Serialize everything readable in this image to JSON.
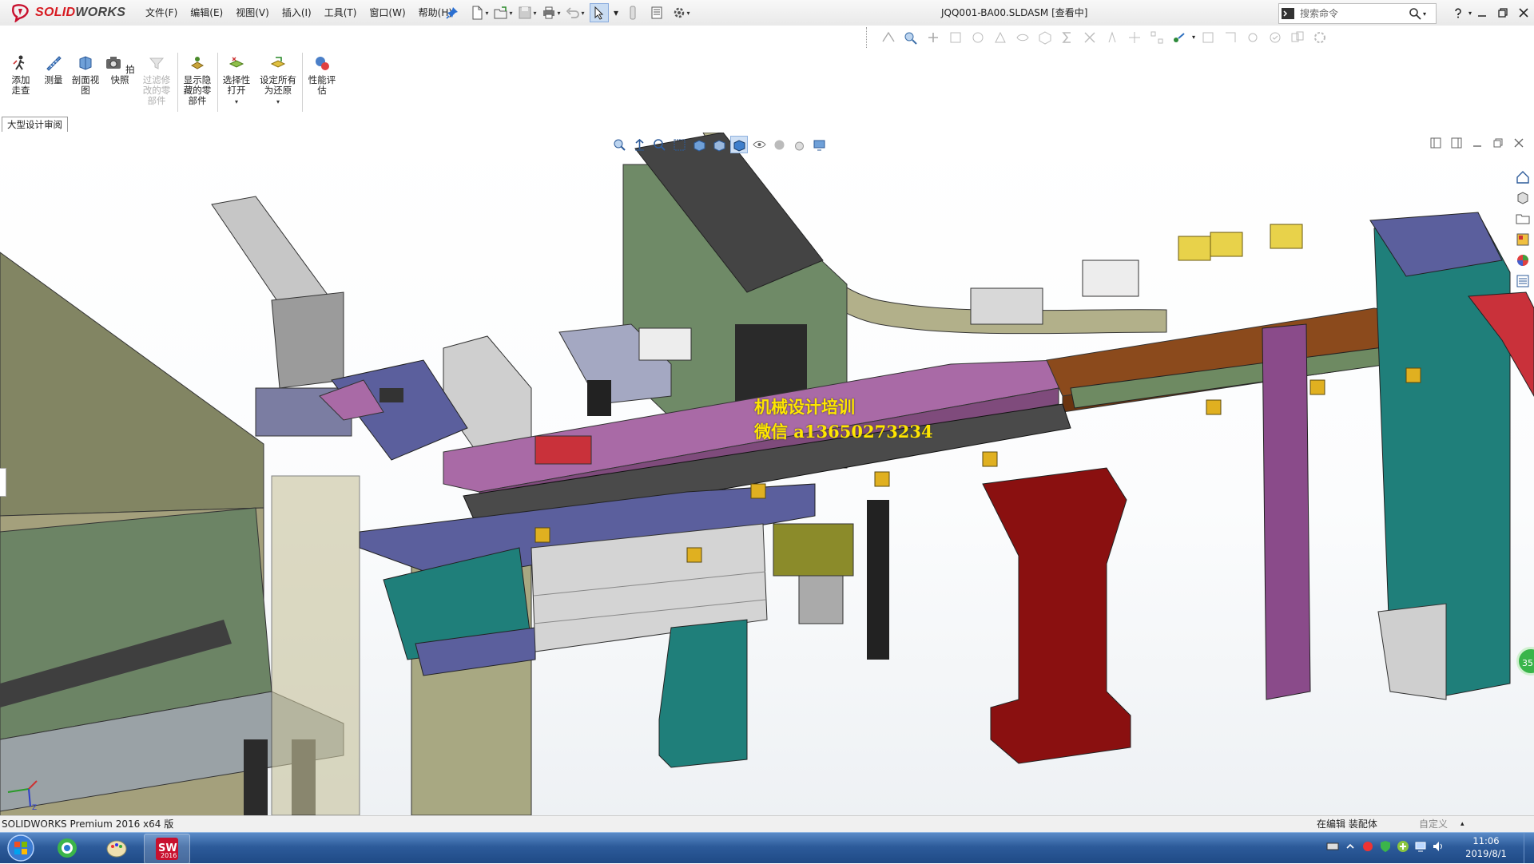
{
  "app": {
    "logo_ds": "DS",
    "logo_solid": "SOLID",
    "logo_works": "WORKS",
    "document_title": "JQQ001-BA00.SLDASM [查看中]"
  },
  "menu": [
    "文件(F)",
    "编辑(E)",
    "视图(V)",
    "插入(I)",
    "工具(T)",
    "窗口(W)",
    "帮助(H)"
  ],
  "search": {
    "placeholder": "搜索命令"
  },
  "ribbon": {
    "walkthrough": "添加走查",
    "measure": "测量",
    "section_view": "剖面视图",
    "snapshot": "拍快照",
    "filter_modified": "过滤修改的零部件",
    "show_hidden": "显示隐藏的零部件",
    "selective_open": "选择性打开",
    "set_all_restore": "设定所有为还原",
    "performance_eval": "性能评估"
  },
  "tab": {
    "large_design_review": "大型设计审阅"
  },
  "watermark": {
    "line1": "机械设计培训",
    "line2": "微信 a13650273234"
  },
  "badge": {
    "green": "35"
  },
  "status": {
    "product": "SOLIDWORKS Premium 2016 x64 版",
    "editing": "在编辑 装配体",
    "custom": "自定义"
  },
  "taskbar": {
    "sw_label": "2016",
    "time": "11:06",
    "date": "2019/8/1"
  },
  "colors": {
    "purple_bar": "#a96aa6",
    "brown_bar": "#8b4a1c",
    "teal": "#1f7f7a",
    "maroon": "#8a1010",
    "olive_green": "#6f8a67",
    "navy_plate": "#5b5f9d",
    "watermark": "#ffe600"
  }
}
